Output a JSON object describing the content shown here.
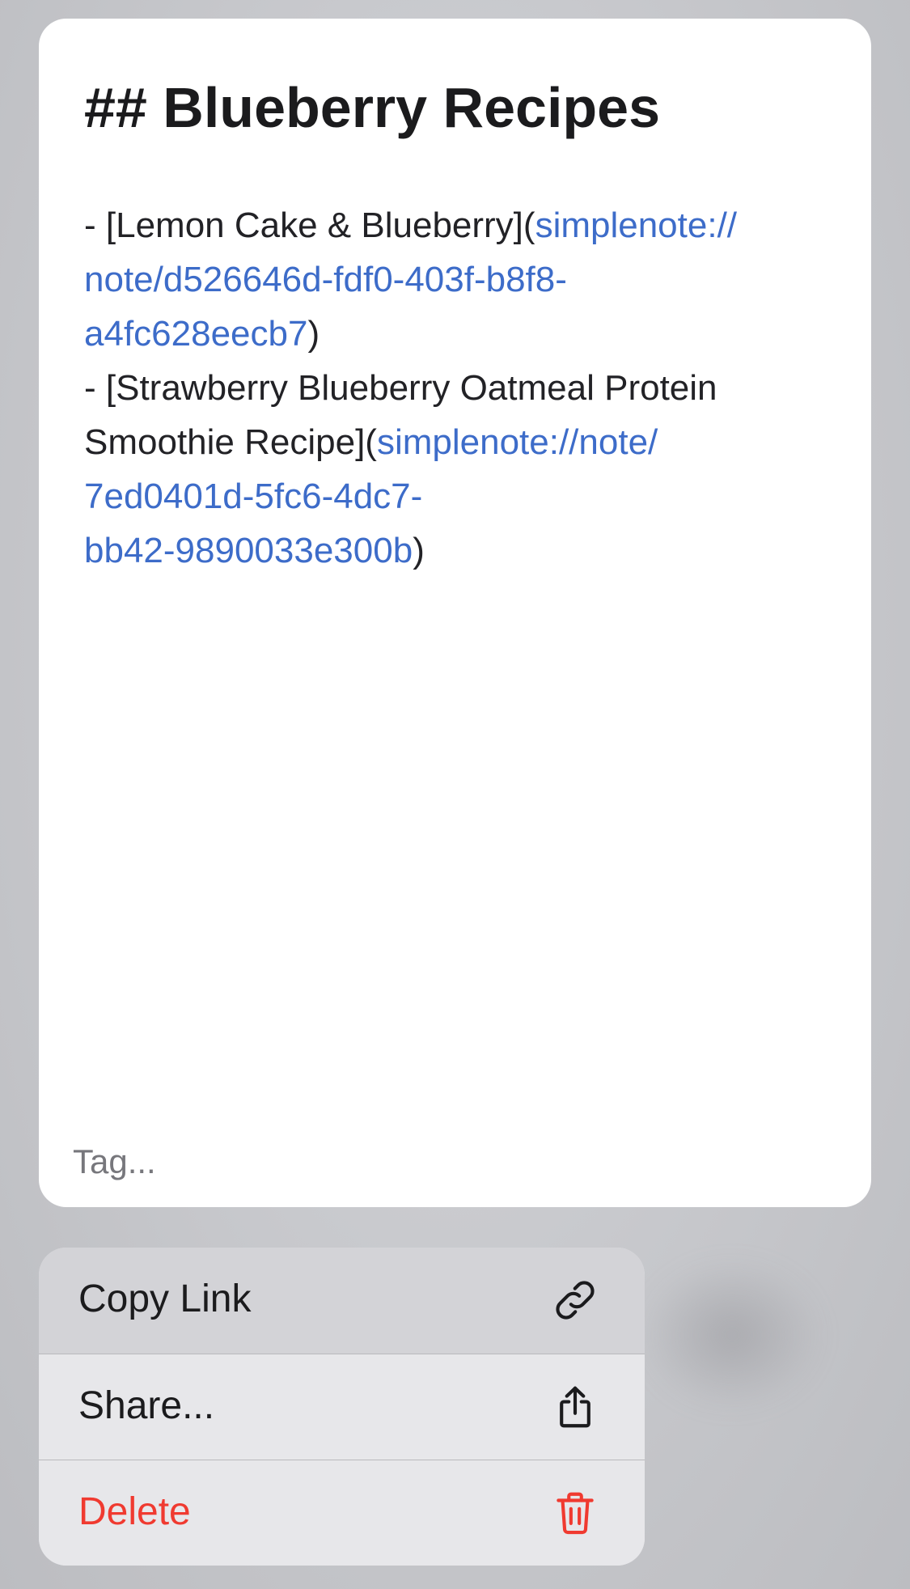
{
  "note": {
    "title": "## Blueberry Recipes",
    "lines": [
      [
        {
          "text": "- [Lemon Cake & Blueberry](",
          "link": false
        },
        {
          "text": "simplenote://",
          "link": true
        }
      ],
      [
        {
          "text": "note/d526646d-fdf0-403f-b8f8-",
          "link": true
        }
      ],
      [
        {
          "text": "a4fc628eecb7",
          "link": true
        },
        {
          "text": ")",
          "link": false
        }
      ],
      [
        {
          "text": "- [Strawberry Blueberry Oatmeal Protein",
          "link": false
        }
      ],
      [
        {
          "text": "Smoothie Recipe](",
          "link": false
        },
        {
          "text": "simplenote://note/",
          "link": true
        }
      ],
      [
        {
          "text": "7ed0401d-5fc6-4dc7-",
          "link": true
        }
      ],
      [
        {
          "text": "bb42-9890033e300b",
          "link": true
        },
        {
          "text": ")",
          "link": false
        }
      ]
    ],
    "tag_placeholder": "Tag..."
  },
  "menu": {
    "copy_link": {
      "label": "Copy Link",
      "icon": "link-icon"
    },
    "share": {
      "label": "Share...",
      "icon": "share-icon"
    },
    "delete": {
      "label": "Delete",
      "icon": "trash-icon"
    }
  },
  "colors": {
    "link": "#3d6cc9",
    "destructive": "#f03a30",
    "text": "#222226",
    "placeholder": "#77777c"
  }
}
